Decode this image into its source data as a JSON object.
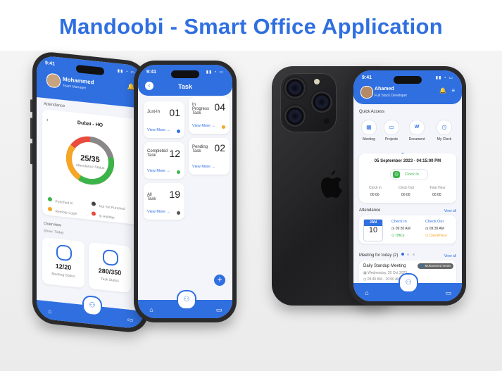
{
  "title": "Mandoobi - Smart Office Application",
  "phone1": {
    "time": "9:41",
    "user_name": "Mohammed",
    "user_role": "Team Manager",
    "section_attendance": "Attendance",
    "location": "Dubai - HO",
    "donut_value": "25/35",
    "donut_label": "Attendance Status",
    "legend": [
      {
        "label": "Punched In",
        "color": "#3bb54a"
      },
      {
        "label": "Not Yet Punched",
        "color": "#444444"
      },
      {
        "label": "Remote Login",
        "color": "#f5a623"
      },
      {
        "label": "In Holiday",
        "color": "#e94b3c"
      }
    ],
    "overview_label": "Overview",
    "show_label": "Show: Today",
    "stats": [
      {
        "value": "12/20",
        "label": "Meeting Status"
      },
      {
        "value": "280/350",
        "label": "Task Status"
      }
    ]
  },
  "phone2": {
    "time": "9:41",
    "header": "Task",
    "tasks": [
      {
        "label": "Just-In",
        "count": "01",
        "link": "View More",
        "dot": "#2f6fe0"
      },
      {
        "label": "In Progress Task",
        "count": "04",
        "link": "View More",
        "dot": "#f5a623"
      },
      {
        "label": "Completed Task",
        "count": "12",
        "link": "View More",
        "dot": "#3bb54a"
      },
      {
        "label": "Pending Task",
        "count": "02",
        "link": "View More",
        "dot": "#e94b3c"
      },
      {
        "label": "All Task",
        "count": "19",
        "link": "View More",
        "dot": "#555555"
      }
    ],
    "fab": "+"
  },
  "phone4": {
    "time": "9:41",
    "user_name": "Ahamed",
    "user_role": "Full Stack Developer",
    "quick_access_title": "Quick Access",
    "quick_access": [
      {
        "label": "Meeting",
        "icon": "calendar-icon"
      },
      {
        "label": "Projects",
        "icon": "folder-icon"
      },
      {
        "label": "Document",
        "icon": "document-icon"
      },
      {
        "label": "My Clock",
        "icon": "clock-icon"
      }
    ],
    "datetime": "05 September 2023 - 04:15:00 PM",
    "clock_in_button": "Clock In",
    "clock_cols": [
      {
        "label": "Clock In",
        "value": "00:00"
      },
      {
        "label": "Clock Out",
        "value": "00:00"
      },
      {
        "label": "Total Hour",
        "value": "00:00"
      }
    ],
    "attendance_title": "Attendance",
    "view_all": "View all",
    "cal_month": "JAN",
    "cal_day": "10",
    "check_in_title": "Check In",
    "check_in_time": "09:30 AM",
    "check_in_place": "Office",
    "check_out_title": "Check Out",
    "check_out_time": "09:30 AM",
    "check_out_place": "ClientPlace",
    "meeting_title": "Meeting for today (2)",
    "meeting_view_all": "View all",
    "meeting_name": "Daily Standup Meeting",
    "meeting_user": "Muhammed Imran",
    "meeting_date": "Wednesday, 20 Oct 2023",
    "meeting_time": "09:45 AM - 10:00 AM"
  }
}
